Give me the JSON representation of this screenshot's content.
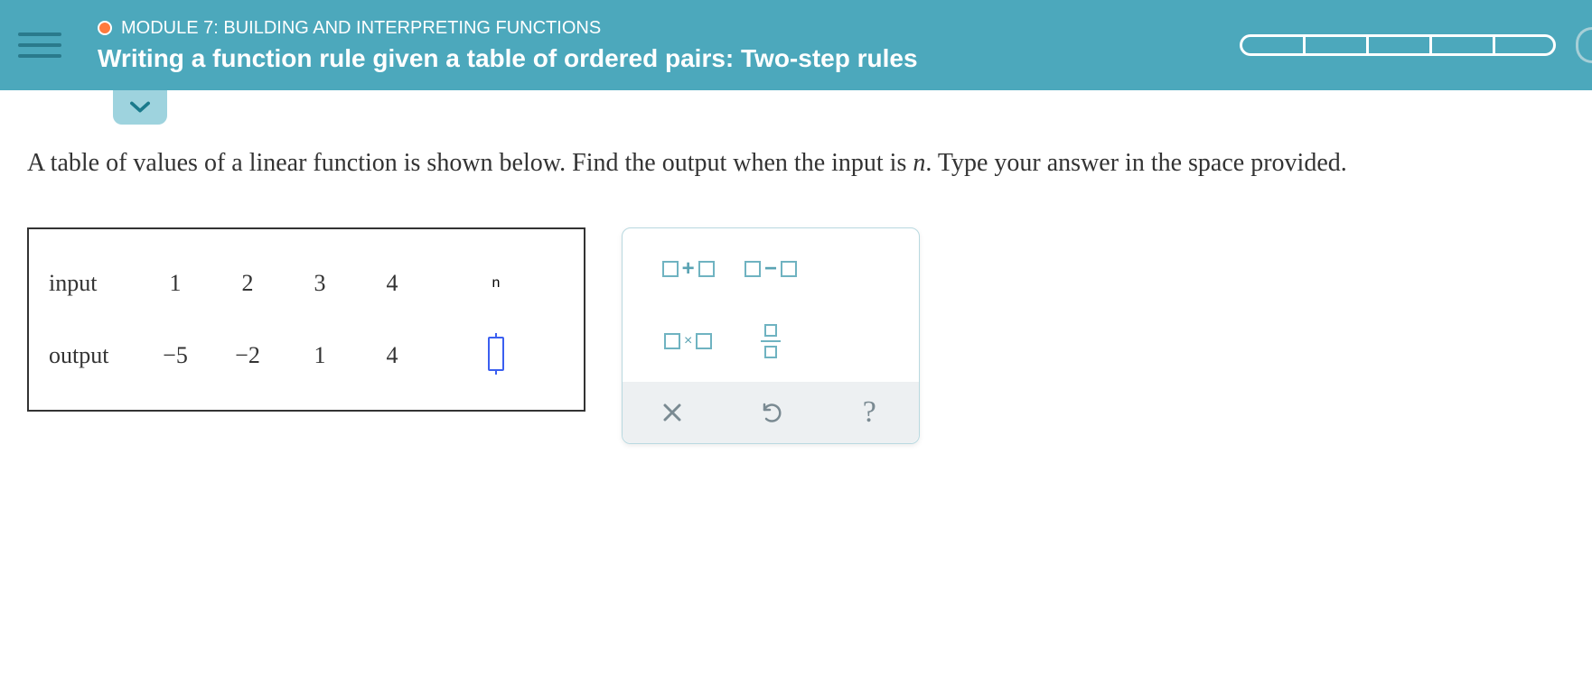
{
  "header": {
    "module_label": "MODULE 7: BUILDING AND INTERPRETING FUNCTIONS",
    "topic_title": "Writing a function rule given a table of ordered pairs: Two-step rules",
    "progress_segments": 5
  },
  "question": {
    "text_before_var": "A table of values of a linear function is shown below. Find the output when the input is ",
    "var": "n",
    "text_after_var": ". Type your answer in the space provided."
  },
  "table": {
    "row_labels": {
      "input": "input",
      "output": "output"
    },
    "columns": [
      {
        "input": "1",
        "output": "−5"
      },
      {
        "input": "2",
        "output": "−2"
      },
      {
        "input": "3",
        "output": "1"
      },
      {
        "input": "4",
        "output": "4"
      }
    ],
    "variable_input": "n",
    "answer_value": ""
  },
  "math_pad": {
    "ops": {
      "add": "+",
      "sub": "−",
      "mul": "×",
      "frac": "fraction"
    },
    "actions": {
      "clear": "×",
      "undo": "↺",
      "help": "?"
    }
  },
  "colors": {
    "header_bg": "#4ca8bc",
    "accent": "#6fb3c1",
    "orange": "#ff7a3d",
    "input_border": "#3b5ff0"
  }
}
